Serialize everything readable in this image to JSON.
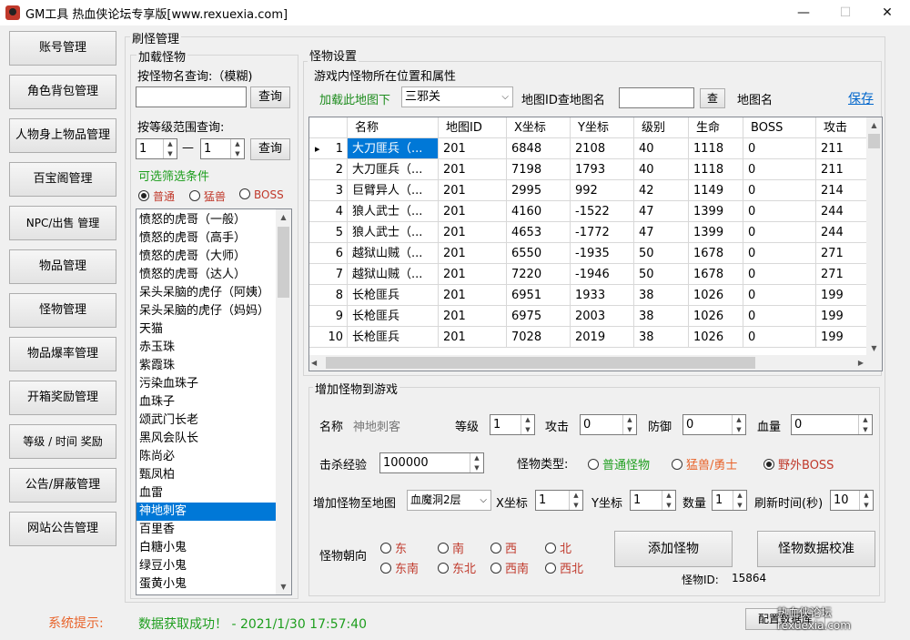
{
  "window": {
    "title": "GM工具 热血侠论坛专享版[www.rexuexia.com]",
    "min": "—",
    "max": "☐",
    "close": "✕"
  },
  "nav": [
    "账号管理",
    "角色背包管理",
    "人物身上物品管理",
    "百宝阁管理",
    "NPC/出售 管理",
    "物品管理",
    "怪物管理",
    "物品爆率管理",
    "开箱奖励管理",
    "等级 / 时间 奖励",
    "公告/屏蔽管理",
    "网站公告管理"
  ],
  "refresh": {
    "title": "刷怪管理",
    "load_title": "加载怪物",
    "name_query_label": "按怪物名查询:（模糊)",
    "name_query_value": "",
    "query_button": "查询",
    "level_range_label": "按等级范围查询:",
    "level_from": "1",
    "level_to": "1",
    "dash": "—",
    "filter_label": "可选筛选条件",
    "filters": [
      "普通",
      "猛兽",
      "BOSS"
    ],
    "monsters": [
      "愤怒的虎哥（一般）",
      "愤怒的虎哥（高手）",
      "愤怒的虎哥（大师）",
      "愤怒的虎哥（达人）",
      "呆头呆脑的虎仔（阿姨）",
      "呆头呆脑的虎仔（妈妈）",
      "天猫",
      "赤玉珠",
      "紫霞珠",
      "污染血珠子",
      "血珠子",
      "颂武门长老",
      "黑风会队长",
      "陈尚必",
      "甄凤柏",
      "血雷",
      "神地刺客",
      "百里香",
      "白糖小鬼",
      "绿豆小鬼",
      "蛋黄小鬼"
    ],
    "selected_monster": "神地刺客"
  },
  "settings": {
    "title": "怪物设置",
    "positions_title": "游戏内怪物所在位置和属性",
    "load_map_label": "加载此地图下",
    "map_value": "三邪关",
    "map_id_label": "地图ID查地图名",
    "map_id_value": "",
    "search_button": "查",
    "map_name_label": "地图名",
    "save_link": "保存"
  },
  "grid": {
    "columns": [
      "名称",
      "地图ID",
      "X坐标",
      "Y坐标",
      "级别",
      "生命",
      "BOSS",
      "攻击"
    ],
    "rows": [
      {
        "n": "1",
        "name": "大刀匪兵（...",
        "map": "201",
        "x": "6848",
        "y": "2108",
        "lv": "40",
        "hp": "1118",
        "boss": "0",
        "atk": "211"
      },
      {
        "n": "2",
        "name": "大刀匪兵（...",
        "map": "201",
        "x": "7198",
        "y": "1793",
        "lv": "40",
        "hp": "1118",
        "boss": "0",
        "atk": "211"
      },
      {
        "n": "3",
        "name": "巨臂异人（...",
        "map": "201",
        "x": "2995",
        "y": "992",
        "lv": "42",
        "hp": "1149",
        "boss": "0",
        "atk": "214"
      },
      {
        "n": "4",
        "name": "狼人武士（...",
        "map": "201",
        "x": "4160",
        "y": "-1522",
        "lv": "47",
        "hp": "1399",
        "boss": "0",
        "atk": "244"
      },
      {
        "n": "5",
        "name": "狼人武士（...",
        "map": "201",
        "x": "4653",
        "y": "-1772",
        "lv": "47",
        "hp": "1399",
        "boss": "0",
        "atk": "244"
      },
      {
        "n": "6",
        "name": "越狱山贼（...",
        "map": "201",
        "x": "6550",
        "y": "-1935",
        "lv": "50",
        "hp": "1678",
        "boss": "0",
        "atk": "271"
      },
      {
        "n": "7",
        "name": "越狱山贼（...",
        "map": "201",
        "x": "7220",
        "y": "-1946",
        "lv": "50",
        "hp": "1678",
        "boss": "0",
        "atk": "271"
      },
      {
        "n": "8",
        "name": "长枪匪兵",
        "map": "201",
        "x": "6951",
        "y": "1933",
        "lv": "38",
        "hp": "1026",
        "boss": "0",
        "atk": "199"
      },
      {
        "n": "9",
        "name": "长枪匪兵",
        "map": "201",
        "x": "6975",
        "y": "2003",
        "lv": "38",
        "hp": "1026",
        "boss": "0",
        "atk": "199"
      },
      {
        "n": "10",
        "name": "长枪匪兵",
        "map": "201",
        "x": "7028",
        "y": "2019",
        "lv": "38",
        "hp": "1026",
        "boss": "0",
        "atk": "199"
      }
    ]
  },
  "add": {
    "title": "增加怪物到游戏",
    "name_label": "名称",
    "name_value": "神地刺客",
    "level_label": "等级",
    "level_value": "1",
    "attack_label": "攻击",
    "attack_value": "0",
    "defense_label": "防御",
    "defense_value": "0",
    "hp_label": "血量",
    "hp_value": "0",
    "exp_label": "击杀经验",
    "exp_value": "100000",
    "type_label": "怪物类型:",
    "types": [
      "普通怪物",
      "猛兽/勇士",
      "野外BOSS"
    ],
    "map_label": "增加怪物至地图",
    "map_value": "血魔洞2层",
    "x_label": "X坐标",
    "x_value": "1",
    "y_label": "Y坐标",
    "y_value": "1",
    "count_label": "数量",
    "count_value": "1",
    "refresh_label": "刷新时间(秒)",
    "refresh_value": "10",
    "dir_label": "怪物朝向",
    "dirs": [
      "东",
      "南",
      "西",
      "北",
      "东南",
      "东北",
      "西南",
      "西北"
    ],
    "add_button": "添加怪物",
    "calibrate_button": "怪物数据校准",
    "monster_id_label": "怪物ID:",
    "monster_id_value": "15864"
  },
  "status": {
    "label": "系统提示:",
    "message": "数据获取成功！ - 2021/1/30 17:57:40",
    "config_button": "配置数据库",
    "watermark": "热血侠论坛 rexuexia.com"
  },
  "colors": {
    "accent": "#0078d7",
    "red": "#c0392b",
    "green": "#1e9e1e",
    "orange": "#e8632a"
  }
}
